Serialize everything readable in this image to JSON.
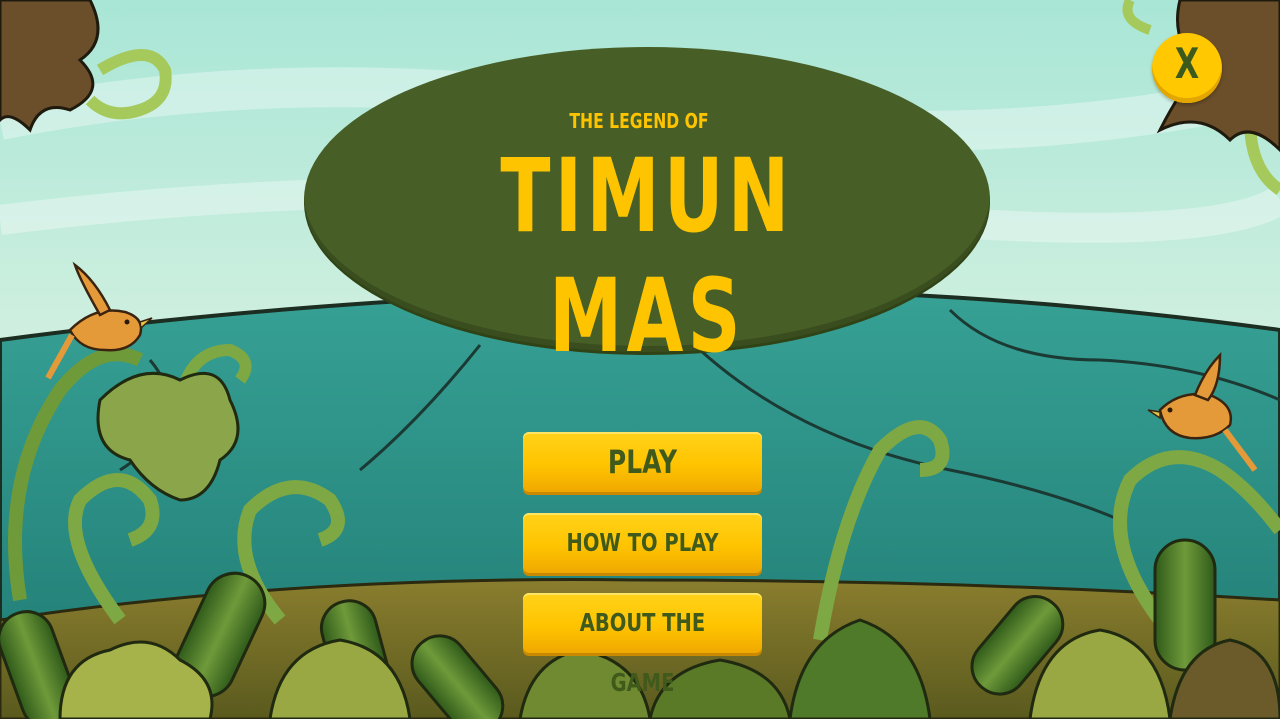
{
  "title": {
    "prefix": "THE LEGEND OF",
    "main": "TIMUN MAS"
  },
  "close_button": {
    "label": "X"
  },
  "menu": {
    "play_label": "PLAY",
    "how_to_play_label": "HOW TO PLAY",
    "about_label": "ABOUT THE GAME"
  },
  "colors": {
    "sky": "#bfe9d8",
    "hill": "#2e8f86",
    "title_oval": "#475f26",
    "title_text": "#ffc400",
    "button": "#ffc400",
    "button_text": "#405a1c"
  }
}
